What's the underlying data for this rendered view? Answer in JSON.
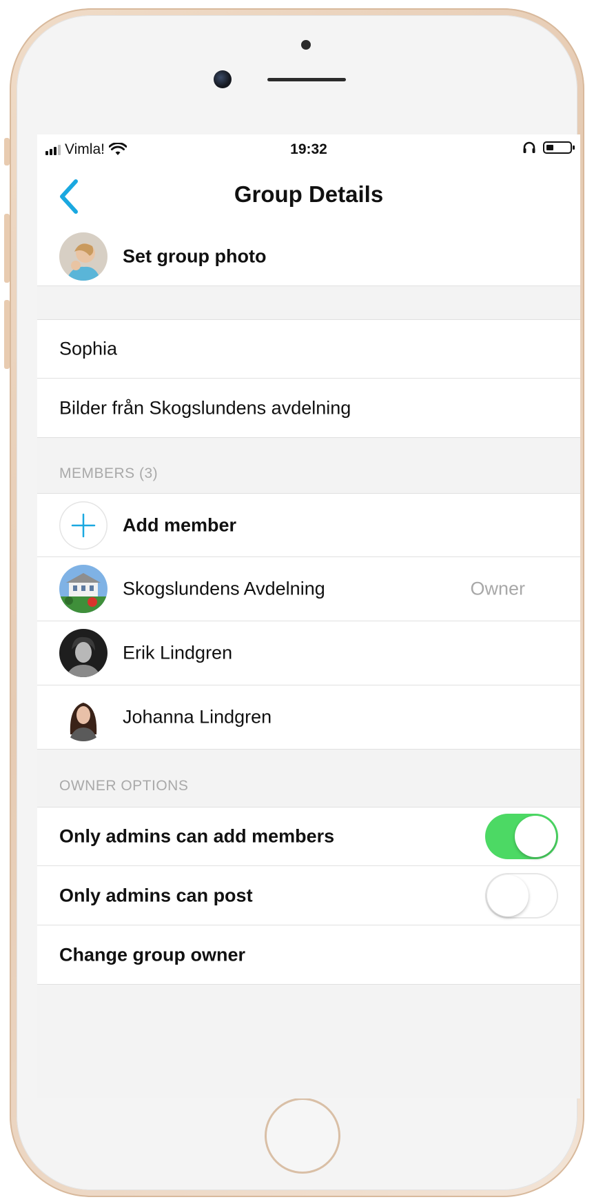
{
  "status_bar": {
    "carrier": "Vimla!",
    "time": "19:32"
  },
  "nav": {
    "title": "Group Details"
  },
  "group_photo": {
    "label": "Set group photo"
  },
  "group_info": {
    "name": "Sophia",
    "description": "Bilder från Skogslundens avdelning"
  },
  "members": {
    "header": "MEMBERS (3)",
    "add_label": "Add member",
    "list": [
      {
        "name": "Skogslundens Avdelning",
        "role": "Owner"
      },
      {
        "name": "Erik Lindgren",
        "role": ""
      },
      {
        "name": "Johanna Lindgren",
        "role": ""
      }
    ]
  },
  "owner_options": {
    "header": "OWNER OPTIONS",
    "only_admins_add": {
      "label": "Only admins can add members",
      "enabled": true
    },
    "only_admins_post": {
      "label": "Only admins can post",
      "enabled": false
    },
    "change_owner": {
      "label": "Change group owner"
    }
  },
  "colors": {
    "accent": "#1aa8e0",
    "toggle_on": "#4cd964"
  }
}
